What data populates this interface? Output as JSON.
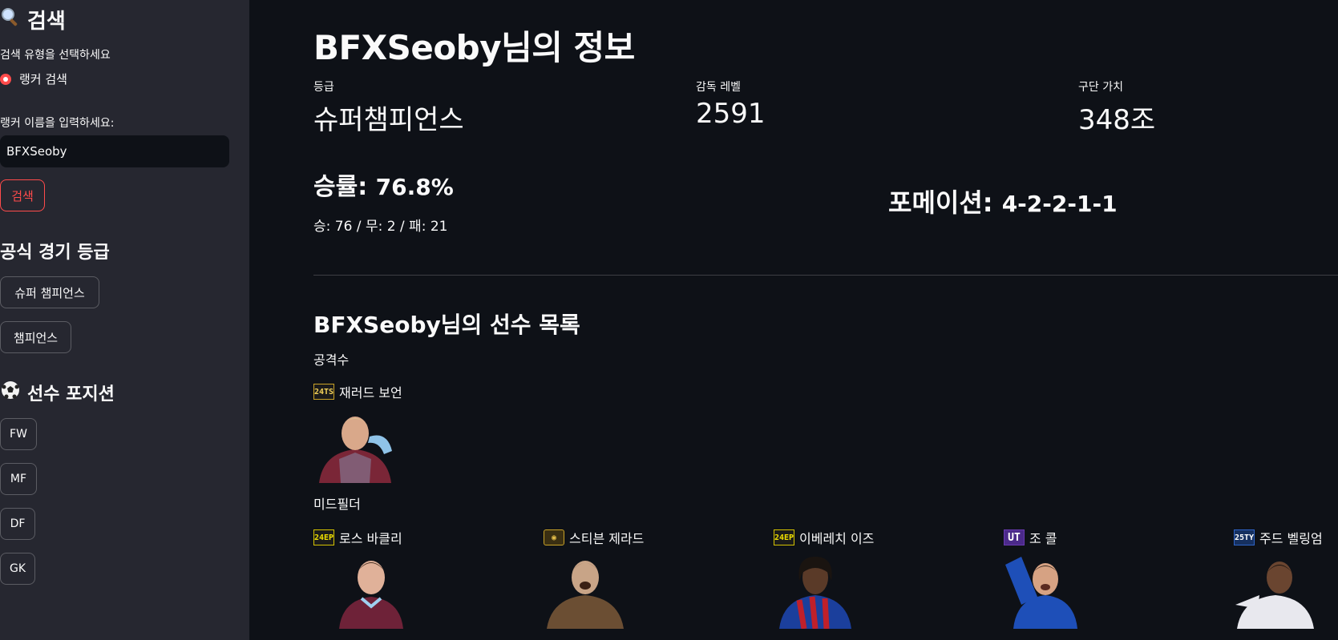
{
  "sidebar": {
    "search_heading": "검색",
    "search_type_label": "검색 유형을 선택하세요",
    "radio_option": "랭커 검색",
    "name_label": "랭커 이름을 입력하세요:",
    "name_value": "BFXSeoby",
    "search_button": "검색",
    "grade_heading": "공식 경기 등급",
    "grade_buttons": [
      "슈퍼 챔피언스",
      "챔피언스"
    ],
    "position_heading": "선수 포지션",
    "position_buttons": [
      "FW",
      "MF",
      "DF",
      "GK"
    ]
  },
  "main": {
    "title": "BFXSeoby님의 정보",
    "metrics": [
      {
        "label": "등급",
        "value": "슈퍼챔피언스"
      },
      {
        "label": "감독 레벨",
        "value": "2591"
      },
      {
        "label": "구단 가치",
        "value": "348조"
      }
    ],
    "win_rate_label": "승률",
    "win_rate_value": "76.8%",
    "record": "승: 76 / 무: 2 / 패: 21",
    "formation_label": "포메이션",
    "formation_value": "4-2-2-1-1",
    "players_heading": "BFXSeoby님의 선수 목록",
    "categories": [
      {
        "name": "공격수",
        "players": [
          {
            "badge": "24TS",
            "name": "재러드 보언",
            "badge_color": "#c9a227",
            "jersey_color": "#7a2637"
          }
        ]
      },
      {
        "name": "미드필더",
        "players": [
          {
            "badge": "24EP",
            "name": "로스 바클리",
            "badge_color": "#d4c300",
            "jersey_color": "#6e2238"
          },
          {
            "badge": "◉",
            "name": "스티븐 제라드",
            "badge_color": "#c9a227",
            "jersey_color": "#6b4e33"
          },
          {
            "badge": "24EP",
            "name": "이베레치 이즈",
            "badge_color": "#d4c300",
            "jersey_color": "#1b3f9c"
          },
          {
            "badge": "UT",
            "name": "조 콜",
            "badge_color": "#6a3ab2",
            "jersey_color": "#1e4fb8"
          },
          {
            "badge": "25TY",
            "name": "주드 벨링엄",
            "badge_color": "#2e64c8",
            "jersey_color": "#e8e8ee"
          }
        ]
      }
    ]
  },
  "colors": {
    "background": "#0e1117",
    "sidebar": "#262730",
    "accent": "#ff4b4b",
    "text": "#fafafa"
  }
}
